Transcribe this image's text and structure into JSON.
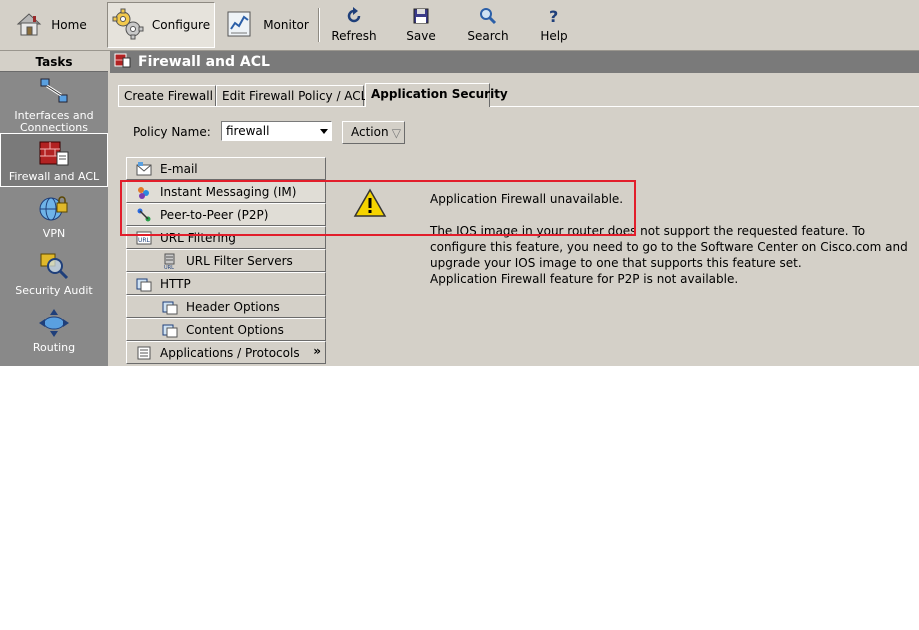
{
  "toolbar": {
    "home": "Home",
    "configure": "Configure",
    "monitor": "Monitor",
    "refresh": "Refresh",
    "save": "Save",
    "search": "Search",
    "help": "Help"
  },
  "sidebar": {
    "header": "Tasks",
    "items": [
      {
        "label_line1": "Interfaces and",
        "label_line2": "Connections"
      },
      {
        "label_line1": "Firewall and ACL",
        "label_line2": ""
      },
      {
        "label_line1": "VPN",
        "label_line2": ""
      },
      {
        "label_line1": "Security Audit",
        "label_line2": ""
      },
      {
        "label_line1": "Routing",
        "label_line2": ""
      }
    ]
  },
  "main": {
    "title": "Firewall and ACL",
    "tabs": [
      {
        "label": "Create Firewall"
      },
      {
        "label": "Edit Firewall Policy / ACL"
      },
      {
        "label": "Application Security"
      }
    ],
    "policy": {
      "label": "Policy Name:",
      "value": "firewall",
      "action_label": "Action"
    },
    "features": [
      {
        "label": "E-mail"
      },
      {
        "label": "Instant Messaging (IM)"
      },
      {
        "label": "Peer-to-Peer (P2P)"
      },
      {
        "label": "URL Filtering"
      },
      {
        "label": "URL Filter Servers"
      },
      {
        "label": "HTTP"
      },
      {
        "label": "Header Options"
      },
      {
        "label": "Content Options"
      },
      {
        "label": "Applications / Protocols",
        "more": "»"
      }
    ],
    "message": {
      "line1": "Application Firewall unavailable.",
      "line2": "The IOS image in your router does not support the requested feature. To configure this feature, you need to go to the Software Center on Cisco.com and upgrade your IOS image to one that supports this feature set.",
      "line3": "Application Firewall feature for P2P is not available."
    }
  },
  "colors": {
    "chrome": "#d4d0c8",
    "sidebar": "#898989",
    "title_bar": "#7a7a7a",
    "highlight": "#e21e2b",
    "warning": "#f5d400"
  }
}
